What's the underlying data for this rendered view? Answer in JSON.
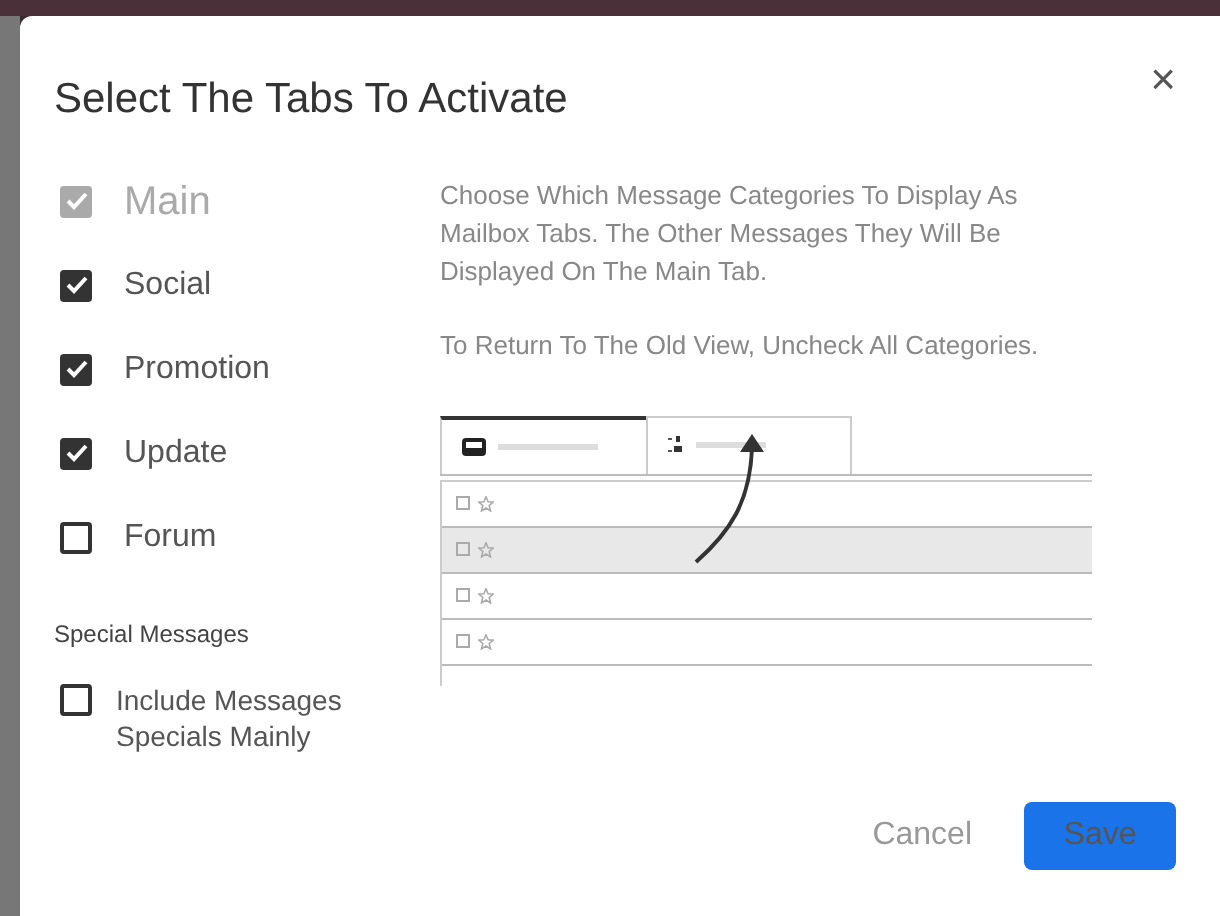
{
  "dialog": {
    "title": "Select The Tabs To Activate",
    "close": "×"
  },
  "categories": [
    {
      "label": "Main",
      "checked": true,
      "disabled": true
    },
    {
      "label": "Social",
      "checked": true,
      "disabled": false
    },
    {
      "label": "Promotion",
      "checked": true,
      "disabled": false
    },
    {
      "label": "Update",
      "checked": true,
      "disabled": false
    },
    {
      "label": "Forum",
      "checked": false,
      "disabled": false
    }
  ],
  "special": {
    "heading": "Special Messages",
    "label": "Include Messages Specials Mainly",
    "checked": false
  },
  "description": [
    "Choose Which Message Categories To Display As Mailbox Tabs. The Other Messages They Will Be Displayed On The Main Tab.",
    "To Return To The Old View, Uncheck All Categories."
  ],
  "preview_rows": [
    {
      "highlighted": false
    },
    {
      "highlighted": true
    },
    {
      "highlighted": false
    },
    {
      "highlighted": false
    }
  ],
  "buttons": {
    "cancel": "Cancel",
    "save": "Save"
  }
}
